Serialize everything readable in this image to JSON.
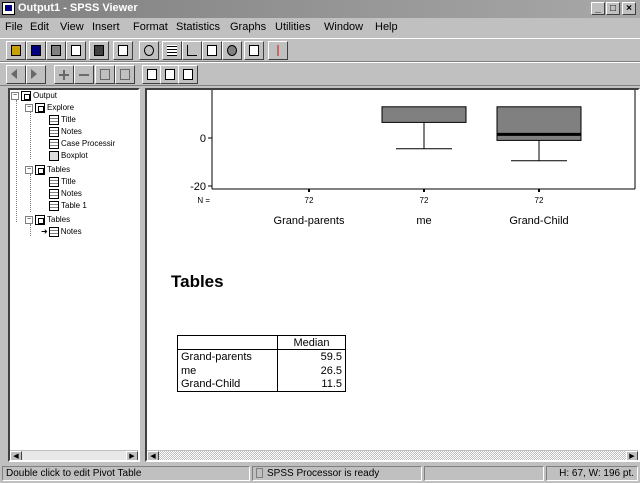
{
  "window": {
    "title": "Output1 - SPSS Viewer",
    "buttons": [
      "_",
      "□",
      "×"
    ]
  },
  "menu": [
    "File",
    "Edit",
    "View",
    "Insert",
    "Format",
    "Statistics",
    "Graphs",
    "Utilities",
    "Window",
    "Help"
  ],
  "tree": {
    "nodes": [
      {
        "label": "Output",
        "icon": "book-icon"
      },
      {
        "label": "Explore",
        "icon": "book-icon"
      },
      {
        "label": "Title",
        "icon": "doc-icon"
      },
      {
        "label": "Notes",
        "icon": "doc-icon"
      },
      {
        "label": "Case Processir",
        "icon": "doc-icon"
      },
      {
        "label": "Boxplot",
        "icon": "chart-icon"
      },
      {
        "label": "Tables",
        "icon": "book-icon"
      },
      {
        "label": "Title",
        "icon": "doc-icon"
      },
      {
        "label": "Notes",
        "icon": "doc-icon"
      },
      {
        "label": "Table 1",
        "icon": "doc-icon"
      },
      {
        "label": "Tables",
        "icon": "book-icon"
      },
      {
        "label": "Notes",
        "icon": "doc-icon"
      }
    ]
  },
  "chart_data": {
    "type": "boxplot",
    "yticks": [
      0,
      -20
    ],
    "ylim": [
      -20,
      12
    ],
    "n_label": "N =",
    "categories": [
      "Grand-parents",
      "me",
      "Grand-Child"
    ],
    "n_values": [
      "72",
      "72",
      "72"
    ],
    "boxes": [
      {
        "name": "me",
        "q1": 6.5,
        "q3": 13,
        "lower_whisker": -4.5,
        "upper_whisker": 13
      },
      {
        "name": "Grand-Child",
        "q1": -1,
        "q3": 13,
        "median": 1.5,
        "lower_whisker": -9.5,
        "upper_whisker": 13
      }
    ]
  },
  "content": {
    "heading": "Tables",
    "pivot": {
      "header": "Median",
      "rows": [
        {
          "label": "Grand-parents",
          "value": "59.5"
        },
        {
          "label": "me",
          "value": "26.5"
        },
        {
          "label": "Grand-Child",
          "value": "11.5"
        }
      ]
    }
  },
  "status": {
    "left": "Double click to edit Pivot Table",
    "middle": "SPSS Processor is ready",
    "right": "H: 67, W: 196  pt."
  }
}
